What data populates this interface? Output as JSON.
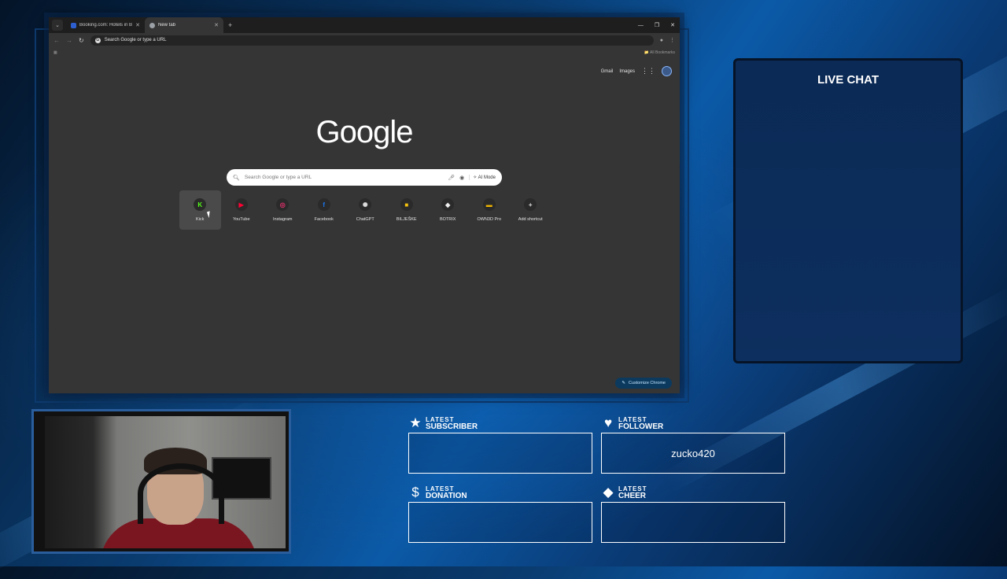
{
  "browser": {
    "tabs": [
      {
        "title": "Booking.com: Hotels in Banja L",
        "active": false
      },
      {
        "title": "New tab",
        "active": true
      }
    ],
    "address_placeholder": "Search Google or type a URL",
    "bookmarks_label": "All Bookmarks"
  },
  "ntp": {
    "top_links": [
      "Gmail",
      "Images"
    ],
    "logo": "Google",
    "search_placeholder": "Search Google or type a URL",
    "ai_mode": "AI Mode",
    "shortcuts": [
      {
        "label": "Kick",
        "glyph": "K",
        "color": "#53fc18"
      },
      {
        "label": "YouTube",
        "glyph": "▶",
        "color": "#ff0033"
      },
      {
        "label": "Instagram",
        "glyph": "◎",
        "color": "#e1306c"
      },
      {
        "label": "Facebook",
        "glyph": "f",
        "color": "#1877f2"
      },
      {
        "label": "ChatGPT",
        "glyph": "✺",
        "color": "#dddddd"
      },
      {
        "label": "BILJEŠKE",
        "glyph": "■",
        "color": "#f4c20d"
      },
      {
        "label": "BOTRIX",
        "glyph": "◆",
        "color": "#eeeeee"
      },
      {
        "label": "OWN3D Pro",
        "glyph": "▬",
        "color": "#f0b400"
      },
      {
        "label": "Add shortcut",
        "glyph": "+",
        "color": "#dddddd"
      }
    ],
    "customize_label": "Customize Chrome"
  },
  "live_chat": {
    "title": "LIVE CHAT"
  },
  "widgets": [
    {
      "small": "LATEST",
      "big": "SUBSCRIBER",
      "icon": "★",
      "value": ""
    },
    {
      "small": "LATEST",
      "big": "FOLLOWER",
      "icon": "♥",
      "value": "zucko420"
    },
    {
      "small": "LATEST",
      "big": "DONATION",
      "icon": "$",
      "value": ""
    },
    {
      "small": "LATEST",
      "big": "CHEER",
      "icon": "◆",
      "value": ""
    }
  ]
}
